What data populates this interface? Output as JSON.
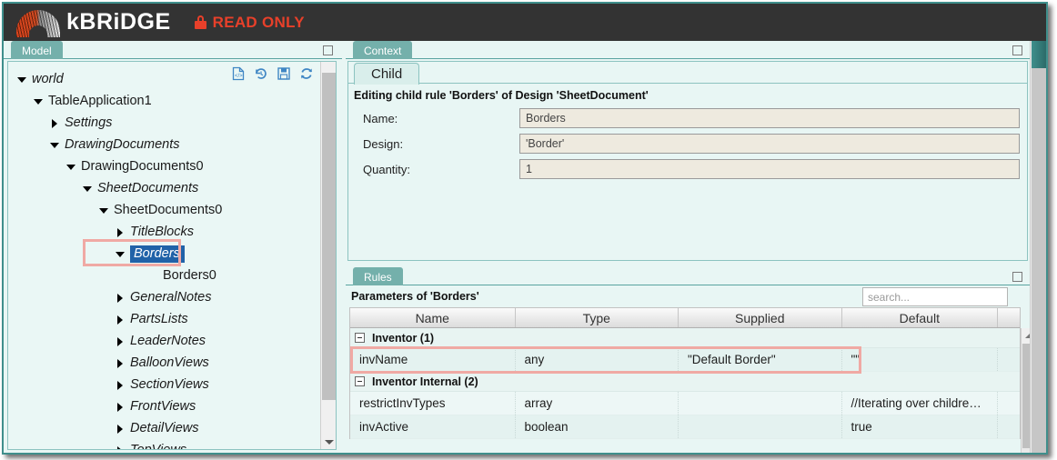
{
  "topbar": {
    "brand": "kBRiDGE",
    "status_label": "READ ONLY",
    "lock_icon": "lock-icon",
    "brand_color": "#ffffff",
    "status_color": "#e8402a",
    "background": "#333333"
  },
  "model_panel": {
    "tab_label": "Model",
    "toolbar": [
      {
        "icon": "script-document-icon",
        "title": "script"
      },
      {
        "icon": "undo-history-icon",
        "title": "undo"
      },
      {
        "icon": "save-floppy-icon",
        "title": "save"
      },
      {
        "icon": "refresh-icon",
        "title": "refresh"
      }
    ],
    "tree": [
      {
        "label": "world",
        "depth": 0,
        "state": "open",
        "italic": true,
        "selected": false
      },
      {
        "label": "TableApplication1",
        "depth": 1,
        "state": "open",
        "italic": false,
        "selected": false
      },
      {
        "label": "Settings",
        "depth": 2,
        "state": "closed",
        "italic": true,
        "selected": false
      },
      {
        "label": "DrawingDocuments",
        "depth": 2,
        "state": "open",
        "italic": true,
        "selected": false
      },
      {
        "label": "DrawingDocuments0",
        "depth": 3,
        "state": "open",
        "italic": false,
        "selected": false
      },
      {
        "label": "SheetDocuments",
        "depth": 4,
        "state": "open",
        "italic": true,
        "selected": false
      },
      {
        "label": "SheetDocuments0",
        "depth": 5,
        "state": "open",
        "italic": false,
        "selected": false
      },
      {
        "label": "TitleBlocks",
        "depth": 6,
        "state": "closed",
        "italic": true,
        "selected": false
      },
      {
        "label": "Borders",
        "depth": 6,
        "state": "open",
        "italic": true,
        "selected": true
      },
      {
        "label": "Borders0",
        "depth": 8,
        "state": "none",
        "italic": false,
        "selected": false
      },
      {
        "label": "GeneralNotes",
        "depth": 6,
        "state": "closed",
        "italic": true,
        "selected": false
      },
      {
        "label": "PartsLists",
        "depth": 6,
        "state": "closed",
        "italic": true,
        "selected": false
      },
      {
        "label": "LeaderNotes",
        "depth": 6,
        "state": "closed",
        "italic": true,
        "selected": false
      },
      {
        "label": "BalloonViews",
        "depth": 6,
        "state": "closed",
        "italic": true,
        "selected": false
      },
      {
        "label": "SectionViews",
        "depth": 6,
        "state": "closed",
        "italic": true,
        "selected": false
      },
      {
        "label": "FrontViews",
        "depth": 6,
        "state": "closed",
        "italic": true,
        "selected": false
      },
      {
        "label": "DetailViews",
        "depth": 6,
        "state": "closed",
        "italic": true,
        "selected": false
      },
      {
        "label": "TopViews",
        "depth": 6,
        "state": "closed",
        "italic": true,
        "selected": false
      }
    ],
    "highlight_color": "#f0a9a4",
    "selection_color": "#2062a8"
  },
  "context_panel": {
    "tab_label": "Context",
    "child_tab_label": "Child",
    "heading": "Editing child rule 'Borders' of Design 'SheetDocument'",
    "fields": [
      {
        "label": "Name:",
        "value": "Borders"
      },
      {
        "label": "Design:",
        "value": "'Border'"
      },
      {
        "label": "Quantity:",
        "value": "1"
      }
    ]
  },
  "rules_panel": {
    "tab_label": "Rules",
    "caption": "Parameters of 'Borders'",
    "search_placeholder": "search...",
    "search_value": "",
    "columns": [
      "Name",
      "Type",
      "Supplied",
      "Default"
    ],
    "groups": [
      {
        "label": "Inventor (1)",
        "collapsed": false,
        "rows": [
          {
            "name": "invName",
            "type": "any",
            "supplied": "\"Default Border\"",
            "default": "\"\"",
            "highlighted": true
          }
        ]
      },
      {
        "label": "Inventor Internal (2)",
        "collapsed": false,
        "rows": [
          {
            "name": "restrictInvTypes",
            "type": "array",
            "supplied": "",
            "default": "//Iterating over childre…",
            "highlighted": false
          },
          {
            "name": "invActive",
            "type": "boolean",
            "supplied": "",
            "default": "true",
            "highlighted": false
          }
        ]
      }
    ],
    "highlight_color": "#f0a9a4"
  }
}
